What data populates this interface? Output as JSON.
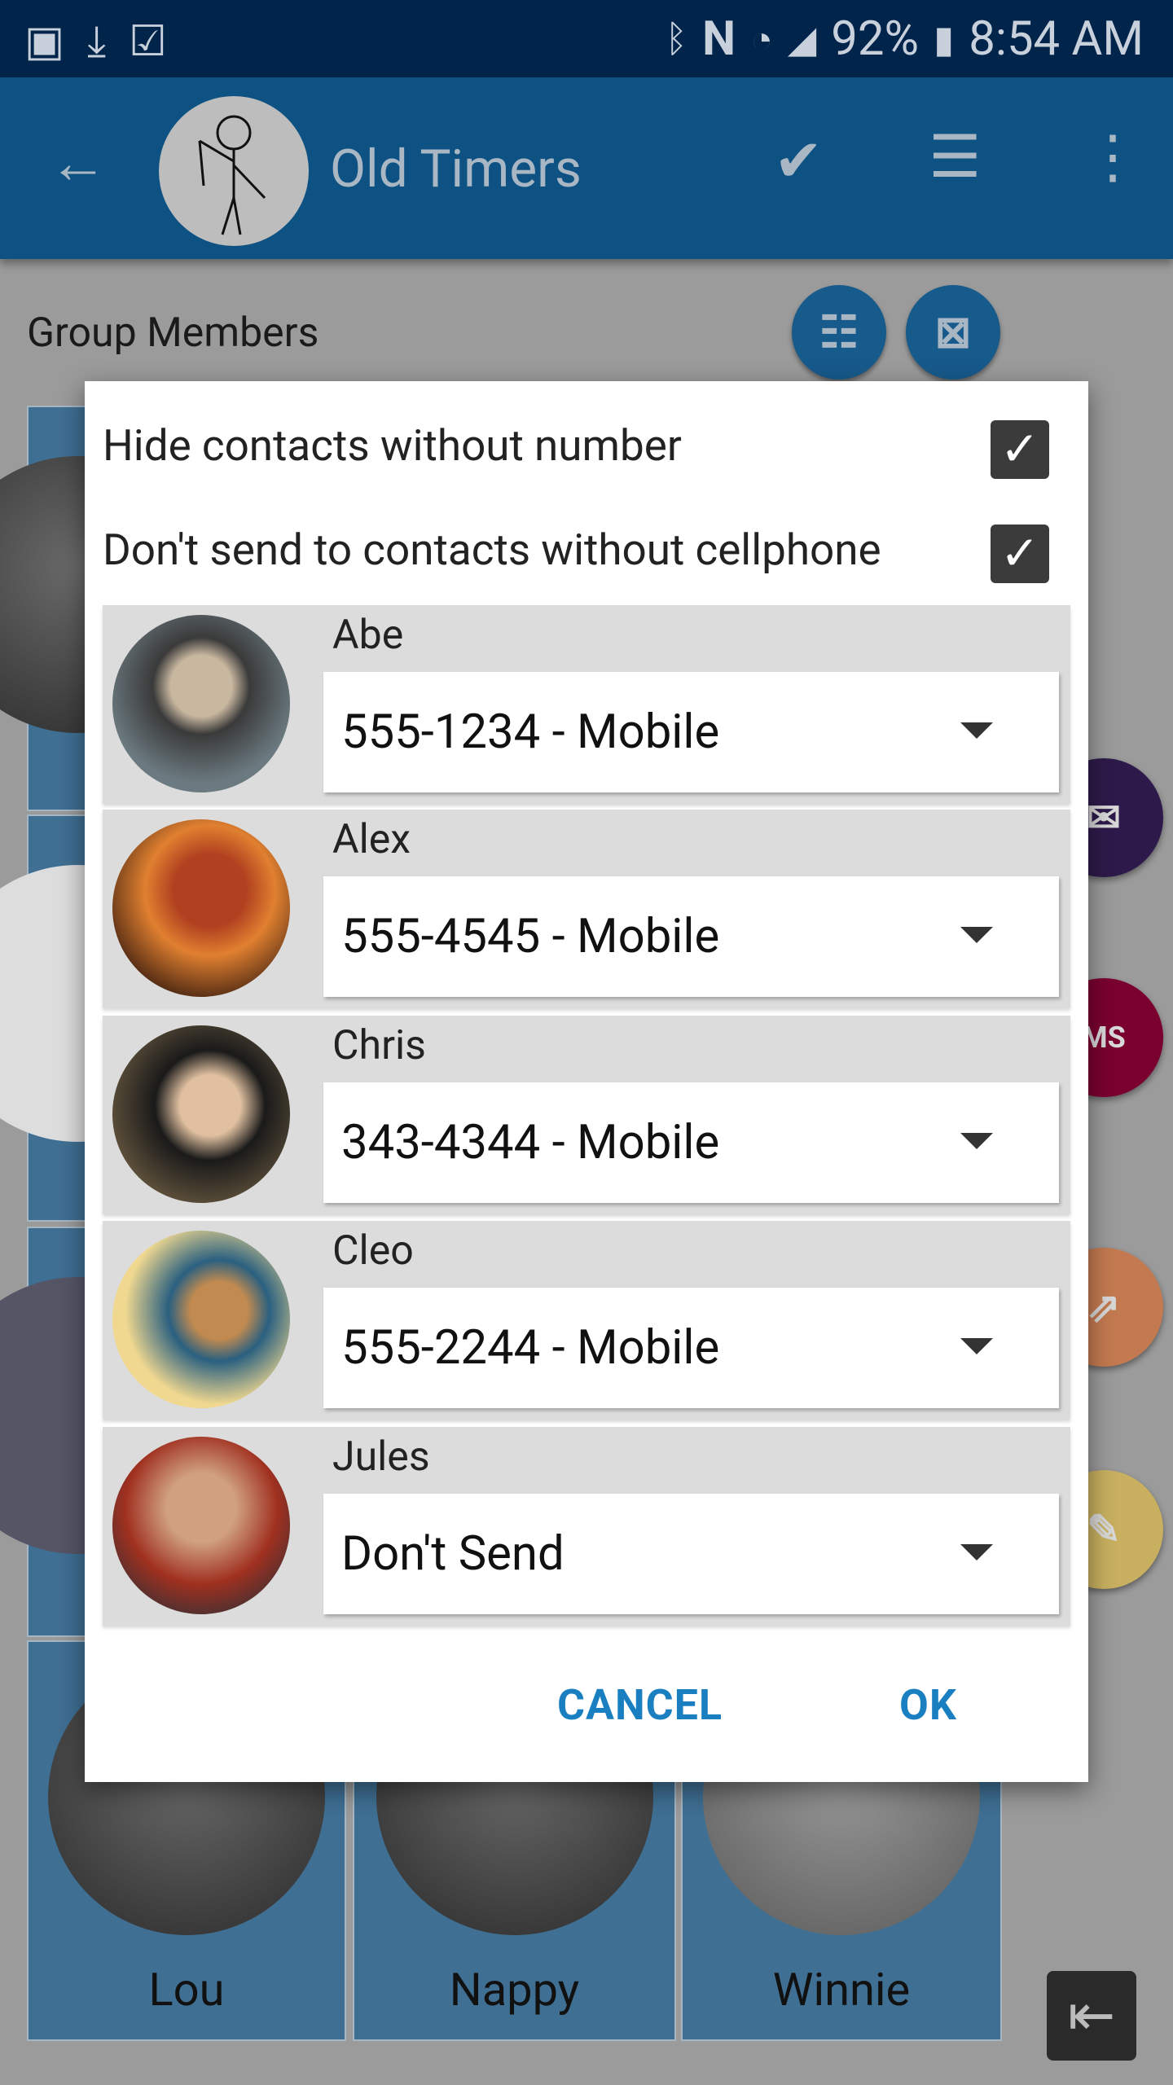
{
  "status_bar": {
    "icons_left": [
      "gallery-icon",
      "download-icon",
      "clipboard-check-icon"
    ],
    "icons_right": [
      "bluetooth-icon",
      "nfc-icon",
      "wifi-icon",
      "signal-icon"
    ],
    "battery": "92%",
    "time": "8:54 AM"
  },
  "app_bar": {
    "title": "Old Timers",
    "actions": [
      "back-icon",
      "check-icon",
      "checklist-icon",
      "more-icon"
    ]
  },
  "section": {
    "title": "Group Members"
  },
  "background_tiles": [
    {
      "label": "Lou"
    },
    {
      "label": "Nappy"
    },
    {
      "label": "Winnie"
    }
  ],
  "fabs": [
    {
      "icon": "email-icon",
      "color": "#2e1a4a"
    },
    {
      "icon": "sms-icon",
      "label": "MS",
      "color": "#7a0030"
    },
    {
      "icon": "share-icon",
      "color": "#c47a50"
    },
    {
      "icon": "edit-icon",
      "color": "#c8b060"
    }
  ],
  "dialog": {
    "options": [
      {
        "label": "Hide contacts without number",
        "checked": true
      },
      {
        "label": "Don't send to contacts without cellphone",
        "checked": true
      }
    ],
    "contacts": [
      {
        "name": "Abe",
        "selection": "555-1234 - Mobile"
      },
      {
        "name": "Alex",
        "selection": "555-4545 - Mobile"
      },
      {
        "name": "Chris",
        "selection": "343-4344 - Mobile"
      },
      {
        "name": "Cleo",
        "selection": "555-2244 - Mobile"
      },
      {
        "name": "Jules",
        "selection": "Don't Send"
      }
    ],
    "cancel_label": "CANCEL",
    "ok_label": "OK",
    "accent": "#1a7fc1"
  }
}
